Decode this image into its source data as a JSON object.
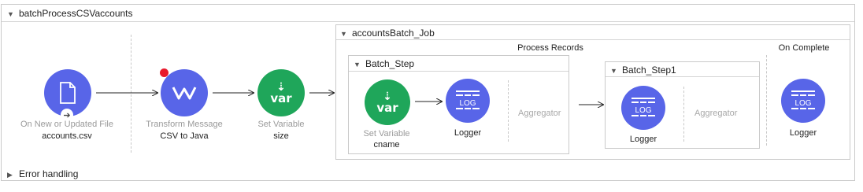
{
  "flow": {
    "name": "batchProcessCSVaccounts"
  },
  "error_handling": {
    "label": "Error handling"
  },
  "components": {
    "source": {
      "type": "On New or Updated File",
      "name": "accounts.csv",
      "icon": "file-icon"
    },
    "transform": {
      "type": "Transform Message",
      "name": "CSV to Java",
      "icon": "dataweave-icon"
    },
    "set_variable": {
      "type": "Set Variable",
      "name": "size",
      "icon_text": "var"
    }
  },
  "batch_job": {
    "name": "accountsBatch_Job",
    "process_records_label": "Process Records",
    "on_complete_label": "On Complete",
    "step1": {
      "name": "Batch_Step",
      "set_variable": {
        "type": "Set Variable",
        "name": "cname",
        "icon_text": "var"
      },
      "logger": {
        "name": "Logger",
        "icon_text": "LOG"
      },
      "aggregator_label": "Aggregator"
    },
    "step2": {
      "name": "Batch_Step1",
      "logger": {
        "name": "Logger",
        "icon_text": "LOG"
      },
      "aggregator_label": "Aggregator"
    },
    "on_complete_logger": {
      "name": "Logger",
      "icon_text": "LOG"
    }
  },
  "colors": {
    "blue": "#5865e8",
    "green": "#1fa65a",
    "error_dot": "#e8192c"
  }
}
